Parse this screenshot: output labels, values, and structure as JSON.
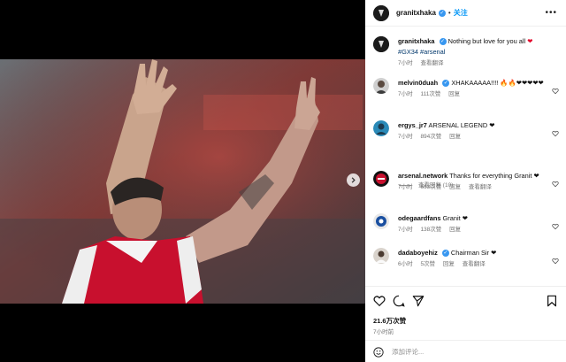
{
  "post": {
    "username": "granitxhaka",
    "follow_label": "关注",
    "separator": "•",
    "caption_user": "granitxhaka",
    "caption_text": "Nothing but love for you all",
    "caption_heart": "❤",
    "hashtags": "#GX34 #arsenal",
    "caption_time": "7小时",
    "caption_translate": "查看翻译"
  },
  "comments": [
    {
      "user": "melvin0duah",
      "verified": true,
      "text": "XHAKAAAAA!!!! 🔥🔥❤❤❤❤❤",
      "time": "7小时",
      "likes": "111次赞",
      "reply": "回复"
    },
    {
      "user": "ergys_jr7",
      "verified": false,
      "text": "ARSENAL LEGEND ❤",
      "time": "7小时",
      "likes": "894次赞",
      "reply": "回复",
      "view_replies": "查看回复 (10)"
    },
    {
      "user": "arsenal.network",
      "verified": false,
      "text": "Thanks for everything Granit ❤",
      "time": "7小时",
      "likes": "663次赞",
      "reply": "回复",
      "translate": "查看翻译"
    },
    {
      "user": "odegaardfans",
      "verified": false,
      "text": "Granit ❤",
      "time": "7小时",
      "likes": "138次赞",
      "reply": "回复"
    },
    {
      "user": "dadaboyehiz",
      "verified": true,
      "text": "Chairman Sir ❤",
      "time": "6小时",
      "likes": "5次赞",
      "reply": "回复",
      "translate": "查看翻译"
    }
  ],
  "actions": {
    "likes": "21.6万次赞",
    "time_ago": "7小时前"
  },
  "add_comment": {
    "placeholder": "添加评论..."
  },
  "icons": [
    "next-arrow-icon",
    "more-icon",
    "heart-icon",
    "comment-icon",
    "share-icon",
    "bookmark-icon",
    "emoji-icon",
    "verified-icon"
  ],
  "colors": {
    "accent": "#0095f6",
    "verified": "#3897f0",
    "heart": "#e3092b",
    "jersey": "#c8102e"
  }
}
